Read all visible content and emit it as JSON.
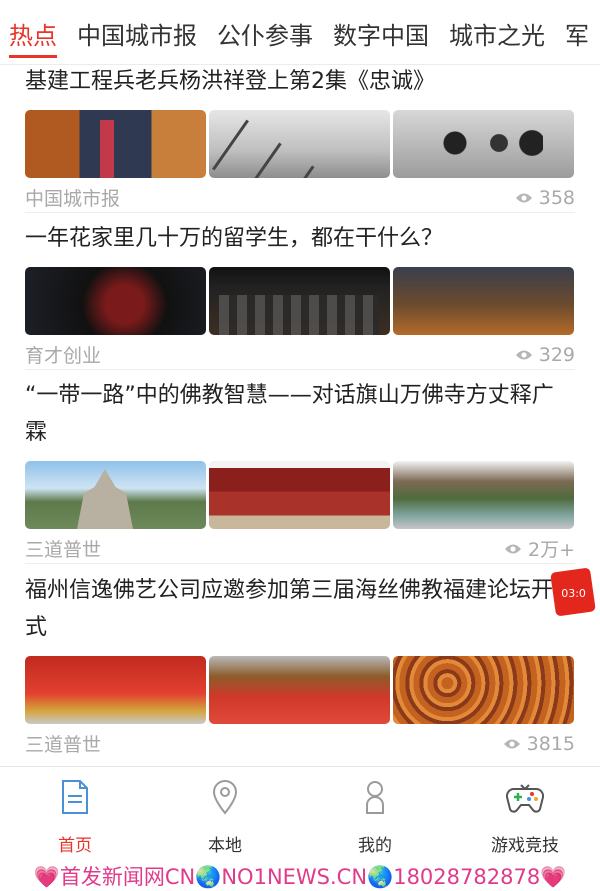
{
  "tabs": [
    "热点",
    "中国城市报",
    "公仆参事",
    "数字中国",
    "城市之光",
    "军"
  ],
  "articles": [
    {
      "title": "基建工程兵老兵杨洪祥登上第2集《忠诚》",
      "source": "中国城市报",
      "views": "358"
    },
    {
      "title": "一年花家里几十万的留学生，都在干什么？",
      "source": "育才创业",
      "views": "329"
    },
    {
      "title": "“一带一路”中的佛教智慧——对话旗山万佛寺方丈释广霖",
      "source": "三道普世",
      "views": "2万+"
    },
    {
      "title": "福州信逸佛艺公司应邀参加第三届海丝佛教福建论坛开幕式",
      "source": "三道普世",
      "views": "3815"
    }
  ],
  "float_badge": {
    "time": "03:0"
  },
  "bottom_nav": [
    {
      "label": "首页",
      "icon": "document-icon",
      "active": true
    },
    {
      "label": "本地",
      "icon": "location-pin-icon",
      "active": false
    },
    {
      "label": "我的",
      "icon": "user-icon",
      "active": false
    },
    {
      "label": "游戏竞技",
      "icon": "gamepad-icon",
      "active": false
    }
  ],
  "watermark": "💗首发新闻网CN🌏NO1NEWS.CN🌏18028782878💗",
  "colors": {
    "accent": "#e8342a",
    "meta": "#a9a9a9",
    "watermark": "#e03a8a"
  }
}
